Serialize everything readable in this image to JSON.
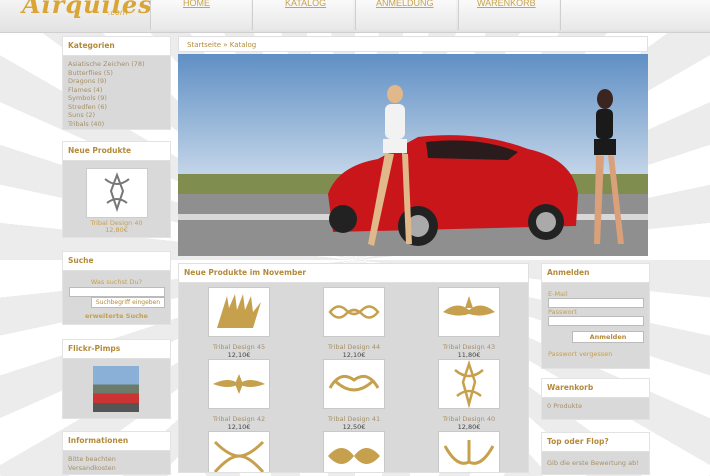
{
  "header": {
    "logo": "Airquiles",
    "logo_sub": ".com",
    "nav": [
      "HOME",
      "KATALOG",
      "ANMELDUNG",
      "WARENKORB"
    ]
  },
  "categories": {
    "title": "Kategorien",
    "items": [
      "Asiatische Zeichen (78)",
      "Butterflies (5)",
      "Dragons (9)",
      "Flames (4)",
      "Symbols (9)",
      "Stredfen (6)",
      "Suns (2)",
      "Tribals (40)"
    ]
  },
  "new_products_box": {
    "title": "Neue Produkte",
    "name": "Tribal Design 40",
    "price": "12,80€"
  },
  "search": {
    "title": "Suche",
    "label": "Was suchst Du?",
    "button": "Suchbegriff eingeben",
    "advanced": "erweiterte Suche"
  },
  "flickr": {
    "title": "Flickr-Pimps"
  },
  "info": {
    "title": "Informationen",
    "items": [
      "Bitte beachten",
      "Versandkosten"
    ]
  },
  "breadcrumb": "Startseite » Katalog",
  "products": {
    "title": "Neue Produkte im November",
    "items": [
      {
        "name": "Tribal Design 45",
        "price": "12,10€"
      },
      {
        "name": "Tribal Design 44",
        "price": "12,10€"
      },
      {
        "name": "Tribal Design 43",
        "price": "11,80€"
      },
      {
        "name": "Tribal Design 42",
        "price": "12,10€"
      },
      {
        "name": "Tribal Design 41",
        "price": "12,50€"
      },
      {
        "name": "Tribal Design 40",
        "price": "12,80€"
      },
      {
        "name": "",
        "price": ""
      },
      {
        "name": "",
        "price": ""
      },
      {
        "name": "",
        "price": ""
      }
    ]
  },
  "login": {
    "title": "Anmelden",
    "email_label": "E-Mail",
    "password_label": "Passwort",
    "button": "Anmelden",
    "forgot": "Passwort vergessen"
  },
  "cart": {
    "title": "Warenkorb",
    "content": "0 Produkte"
  },
  "poll": {
    "title": "Top oder Flop?",
    "text": "Gib die erste Bewertung ab!"
  },
  "colors": {
    "accent": "#c6a04d",
    "panel": "#d9d9d9"
  }
}
